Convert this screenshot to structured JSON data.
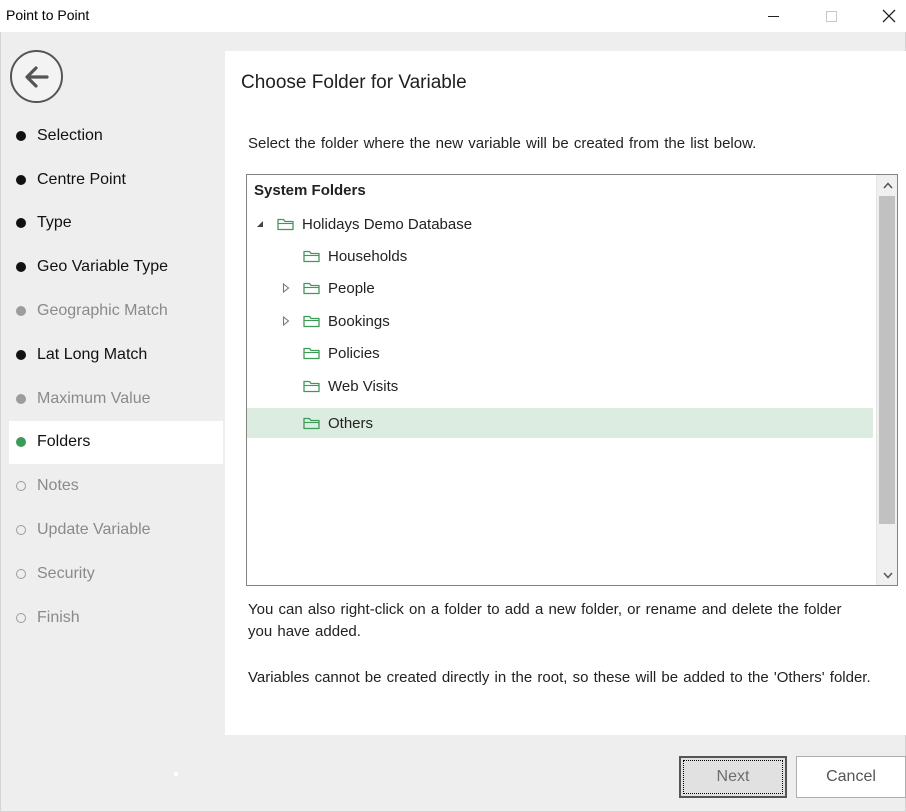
{
  "window": {
    "title": "Point to Point"
  },
  "nav": {
    "steps": [
      {
        "label": "Selection",
        "state": "done"
      },
      {
        "label": "Centre Point",
        "state": "done"
      },
      {
        "label": "Type",
        "state": "done"
      },
      {
        "label": "Geo Variable Type",
        "state": "done"
      },
      {
        "label": "Geographic Match",
        "state": "skipped"
      },
      {
        "label": "Lat Long Match",
        "state": "done"
      },
      {
        "label": "Maximum Value",
        "state": "skipped"
      },
      {
        "label": "Folders",
        "state": "current"
      },
      {
        "label": "Notes",
        "state": "pending"
      },
      {
        "label": "Update Variable",
        "state": "pending"
      },
      {
        "label": "Security",
        "state": "pending"
      },
      {
        "label": "Finish",
        "state": "pending"
      }
    ]
  },
  "main": {
    "heading": "Choose Folder for Variable",
    "instruction": "Select the folder where the new variable will be created from the list below.",
    "tree": {
      "root_label": "System Folders",
      "items": [
        {
          "label": "Holidays Demo Database",
          "level": 0,
          "expander": "expanded"
        },
        {
          "label": "Households",
          "level": 1,
          "expander": "none"
        },
        {
          "label": "People",
          "level": 1,
          "expander": "collapsed"
        },
        {
          "label": "Bookings",
          "level": 1,
          "expander": "collapsed"
        },
        {
          "label": "Policies",
          "level": 1,
          "expander": "none"
        },
        {
          "label": "Web Visits",
          "level": 1,
          "expander": "none"
        },
        {
          "label": "Others",
          "level": 1,
          "expander": "none",
          "selected": true
        }
      ]
    },
    "help_rename": "You can also right-click on a folder to add a new folder, or rename and delete the folder you have added.",
    "help_root": "Variables cannot be created directly in the root, so these will be added to the 'Others' folder."
  },
  "footer": {
    "next_label": "Next",
    "cancel_label": "Cancel"
  },
  "colors": {
    "accent_green": "#3e9a5a",
    "selection_bg": "#dcece0",
    "folder_icon": "#3e9a5a",
    "panel_bg": "#eeeeee"
  },
  "icons": {
    "back": "arrow-left-circle-icon",
    "folder": "folder-icon",
    "expanded": "triangle-down-icon",
    "collapsed": "triangle-right-icon"
  }
}
